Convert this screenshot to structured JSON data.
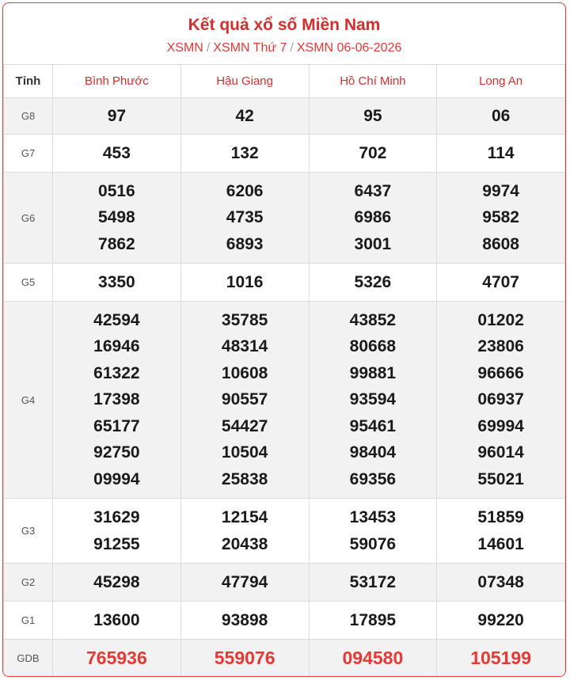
{
  "header": {
    "title": "Kết quả xổ số Miền Nam",
    "breadcrumb": [
      "XSMN",
      "XSMN Thứ 7",
      "XSMN 06-06-2026"
    ]
  },
  "table": {
    "label_header": "Tỉnh",
    "provinces": [
      "Bình Phước",
      "Hậu Giang",
      "Hồ Chí Minh",
      "Long An"
    ],
    "prizes": [
      {
        "label": "G8",
        "values": [
          [
            "97"
          ],
          [
            "42"
          ],
          [
            "95"
          ],
          [
            "06"
          ]
        ]
      },
      {
        "label": "G7",
        "values": [
          [
            "453"
          ],
          [
            "132"
          ],
          [
            "702"
          ],
          [
            "114"
          ]
        ]
      },
      {
        "label": "G6",
        "values": [
          [
            "0516",
            "5498",
            "7862"
          ],
          [
            "6206",
            "4735",
            "6893"
          ],
          [
            "6437",
            "6986",
            "3001"
          ],
          [
            "9974",
            "9582",
            "8608"
          ]
        ]
      },
      {
        "label": "G5",
        "values": [
          [
            "3350"
          ],
          [
            "1016"
          ],
          [
            "5326"
          ],
          [
            "4707"
          ]
        ]
      },
      {
        "label": "G4",
        "values": [
          [
            "42594",
            "16946",
            "61322",
            "17398",
            "65177",
            "92750",
            "09994"
          ],
          [
            "35785",
            "48314",
            "10608",
            "90557",
            "54427",
            "10504",
            "25838"
          ],
          [
            "43852",
            "80668",
            "99881",
            "93594",
            "95461",
            "98404",
            "69356"
          ],
          [
            "01202",
            "23806",
            "96666",
            "06937",
            "69994",
            "96014",
            "55021"
          ]
        ]
      },
      {
        "label": "G3",
        "values": [
          [
            "31629",
            "91255"
          ],
          [
            "12154",
            "20438"
          ],
          [
            "13453",
            "59076"
          ],
          [
            "51859",
            "14601"
          ]
        ]
      },
      {
        "label": "G2",
        "values": [
          [
            "45298"
          ],
          [
            "47794"
          ],
          [
            "53172"
          ],
          [
            "07348"
          ]
        ]
      },
      {
        "label": "G1",
        "values": [
          [
            "13600"
          ],
          [
            "93898"
          ],
          [
            "17895"
          ],
          [
            "99220"
          ]
        ]
      },
      {
        "label": "GDB",
        "values": [
          [
            "765936"
          ],
          [
            "559076"
          ],
          [
            "094580"
          ],
          [
            "105199"
          ]
        ]
      }
    ]
  },
  "colors": {
    "accent": "#e53935",
    "title": "#d32f2f",
    "row_alt": "#f2f2f2",
    "border": "#dcdcdc"
  }
}
